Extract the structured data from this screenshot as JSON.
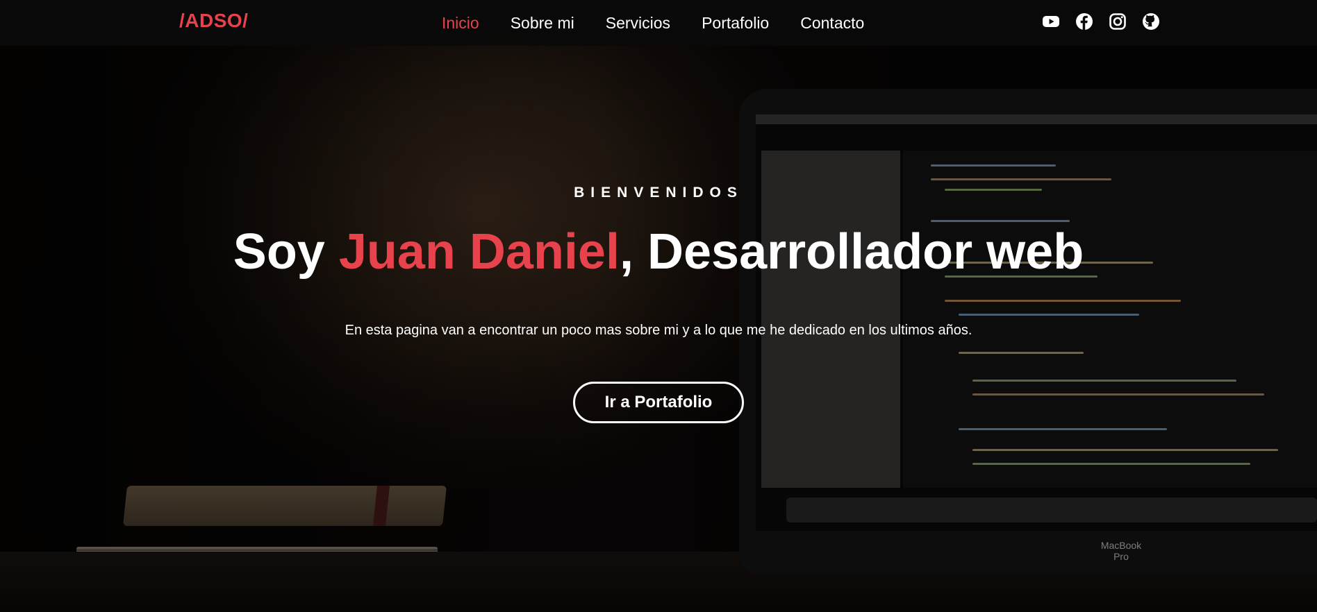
{
  "nav": {
    "logo": "/ADSO/",
    "links": [
      {
        "label": "Inicio",
        "active": true
      },
      {
        "label": "Sobre mi",
        "active": false
      },
      {
        "label": "Servicios",
        "active": false
      },
      {
        "label": "Portafolio",
        "active": false
      },
      {
        "label": "Contacto",
        "active": false
      }
    ],
    "socials": [
      "youtube-icon",
      "facebook-icon",
      "instagram-icon",
      "github-icon"
    ]
  },
  "hero": {
    "kicker": "BIENVENIDOS",
    "headline_prefix": "Soy ",
    "headline_name": "Juan Daniel",
    "headline_suffix": ", Desarrollador web",
    "subtitle": "En esta pagina van a encontrar un poco mas sobre mi y a lo que me he dedicado en los ultimos años.",
    "cta_label": "Ir a Portafolio",
    "background_label": "MacBook Pro"
  },
  "colors": {
    "accent": "#e8424c",
    "navbar": "#0a0a0a",
    "text": "#ffffff"
  }
}
